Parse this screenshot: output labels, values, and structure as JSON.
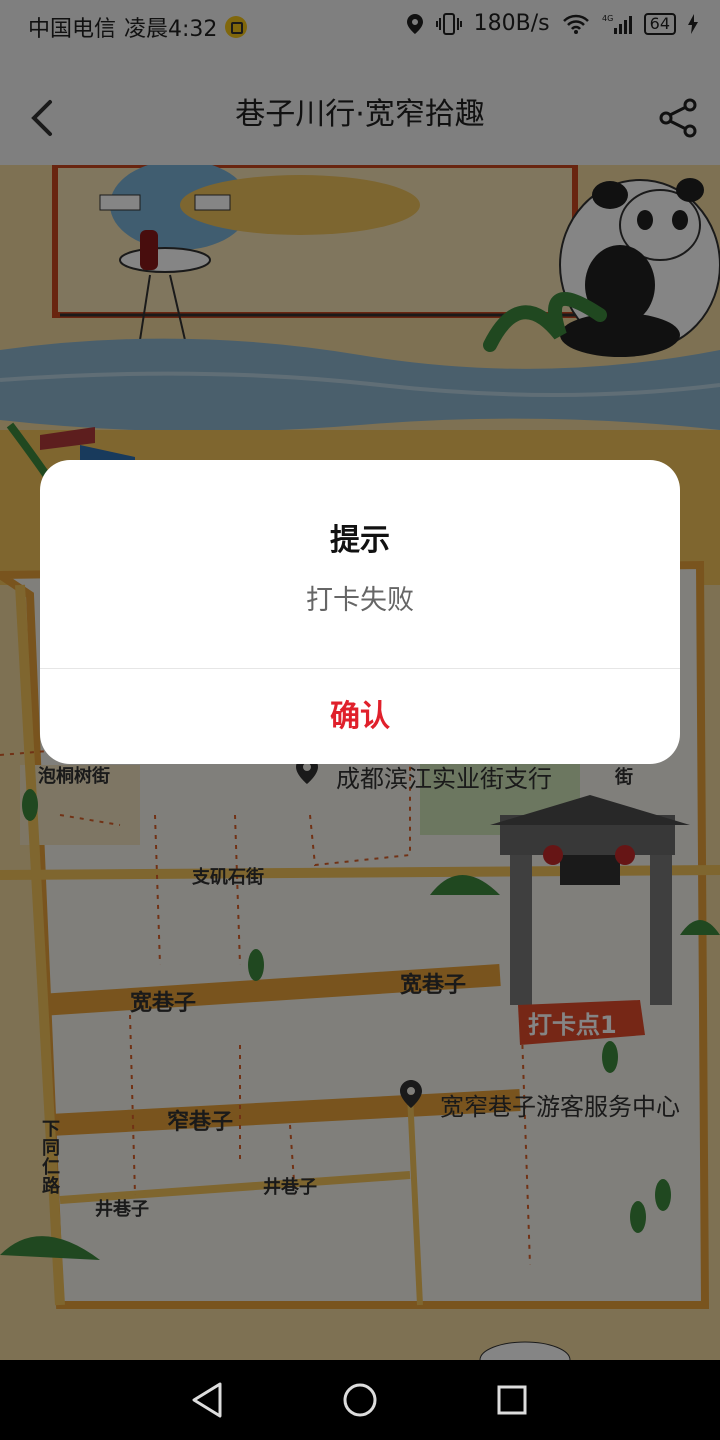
{
  "status_bar": {
    "carrier": "中国电信",
    "time": "凌晨4:32",
    "speed": "180B/s",
    "network": "4G",
    "battery": "64"
  },
  "navbar": {
    "title": "巷子川行·宽窄拾趣",
    "back_icon": "back-arrow-icon",
    "share_icon": "share-icon"
  },
  "map": {
    "labels": {
      "paotongshu": "泡桐树街",
      "bank": "成都滨江实业街支行",
      "zhijishi": "支矶石街",
      "kuan_left": "宽巷子",
      "kuan_right": "宽巷子",
      "zhai": "窄巷子",
      "visitor_center": "宽窄巷子游客服务中心",
      "xiatongren": "下同仁路",
      "jing_left": "井巷子",
      "jing_right": "井巷子",
      "checkpoint": "打卡点1",
      "street_right": "街"
    },
    "colors": {
      "bg": "#f1d9a0",
      "road_main": "#e8a23a",
      "road_side": "#f3c35a",
      "block": "#f6f3ec",
      "river": "#8fb6cf"
    }
  },
  "dialog": {
    "title": "提示",
    "message": "打卡失败",
    "confirm": "确认",
    "confirm_color": "#e0202b"
  }
}
